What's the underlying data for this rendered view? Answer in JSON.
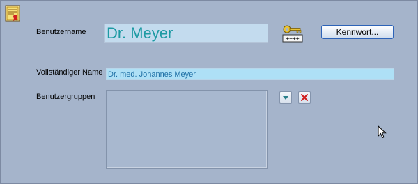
{
  "form": {
    "username_label": "Benutzername",
    "username_value": "Dr. Meyer",
    "fullname_label": "Vollständiger Name",
    "fullname_value": "Dr. med. Johannes Meyer",
    "groups_label": "Benutzergruppen",
    "groups_items": []
  },
  "buttons": {
    "password_label_underlined": "K",
    "password_label_rest": "ennwort...",
    "dropdown_icon": "chevron-down-icon",
    "delete_icon": "close-icon"
  },
  "icons": {
    "app_icon": "certificate-icon",
    "password_icon": "key-icon",
    "key_badge_text": "++++"
  },
  "colors": {
    "background": "#a5b4cb",
    "username_text": "#1d9aa3",
    "fullname_text": "#1e6fa5",
    "delete_red": "#d11a1a",
    "dropdown_teal": "#2a7f8a"
  }
}
